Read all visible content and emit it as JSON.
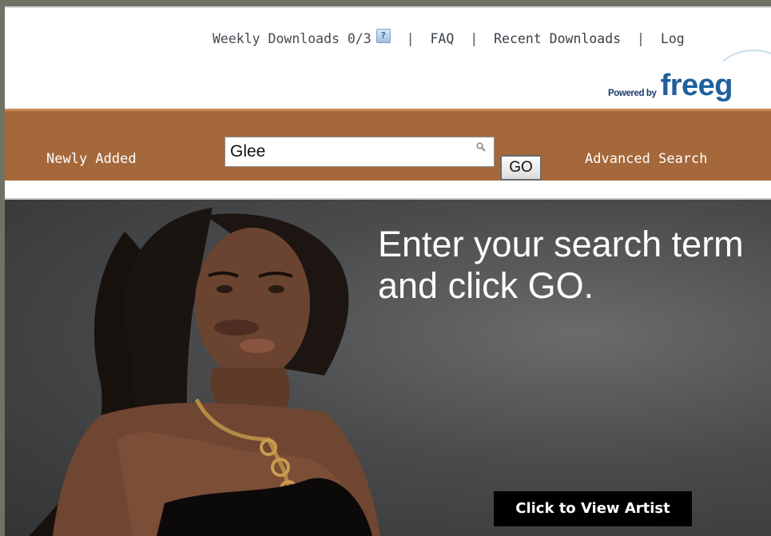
{
  "header": {
    "weekly_downloads": "Weekly Downloads 0/3",
    "help_icon": "help-question-icon",
    "links": {
      "faq": "FAQ",
      "recent": "Recent Downloads",
      "login": "Log"
    },
    "separator": "|",
    "powered_by": "Powered by",
    "brand": "freeg"
  },
  "nav": {
    "newly_added": "Newly Added",
    "search_value": "Glee",
    "search_icon": "magnifier-icon",
    "go_label": "GO",
    "advanced_search": "Advanced Search"
  },
  "hero": {
    "instruction": "Enter your search term and click GO.",
    "view_artist": "Click to View Artist"
  },
  "colors": {
    "navbar": "#a5683a",
    "brand_blue": "#1f5f9c",
    "outer_frame": "#6f7363"
  }
}
